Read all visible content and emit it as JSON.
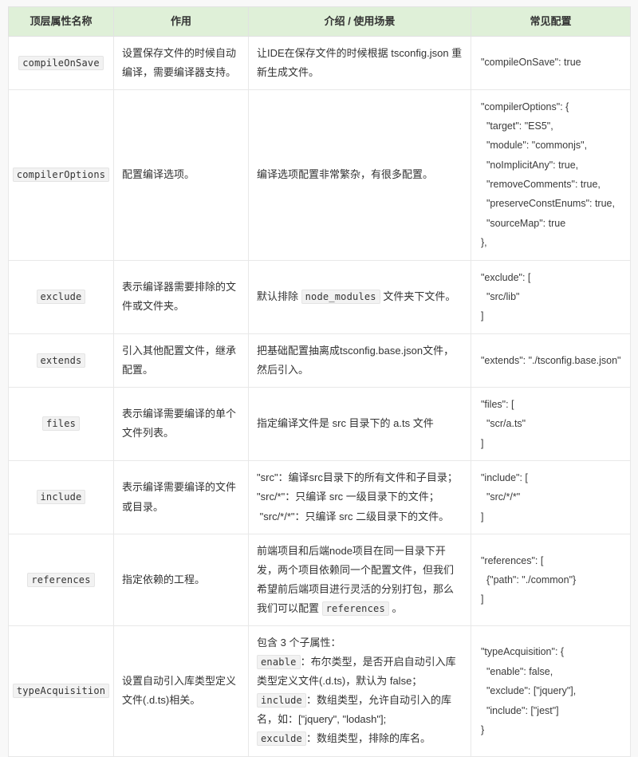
{
  "table": {
    "headers": [
      "顶层属性名称",
      "作用",
      "介绍 / 使用场景",
      "常见配置"
    ],
    "header_bg": "#dff0d8",
    "border_color": "#e2e2e2",
    "page_bg": "#f8f8f8",
    "code_bg": "#f2f2f2",
    "rows": [
      {
        "name": "compileOnSave",
        "role": "设置保存文件的时候自动编译，需要编译器支持。",
        "desc_parts": [
          {
            "type": "text",
            "value": "让IDE在保存文件的时候根据 tsconfig.json 重新生成文件。"
          }
        ],
        "config": "\"compileOnSave\": true"
      },
      {
        "name": "compilerOptions",
        "role": "配置编译选项。",
        "desc_parts": [
          {
            "type": "text",
            "value": "编译选项配置非常繁杂，有很多配置。"
          }
        ],
        "config": "\"compilerOptions\": {\n  \"target\": \"ES5\",\n  \"module\": \"commonjs\",\n  \"noImplicitAny\": true,\n  \"removeComments\": true,\n  \"preserveConstEnums\": true,\n  \"sourceMap\": true\n},"
      },
      {
        "name": "exclude",
        "role": "表示编译器需要排除的文件或文件夹。",
        "desc_parts": [
          {
            "type": "text",
            "value": "默认排除 "
          },
          {
            "type": "code",
            "value": "node_modules"
          },
          {
            "type": "text",
            "value": " 文件夹下文件。"
          }
        ],
        "config": "\"exclude\": [\n  \"src/lib\"\n]"
      },
      {
        "name": "extends",
        "role": "引入其他配置文件，继承配置。",
        "desc_parts": [
          {
            "type": "text",
            "value": "把基础配置抽离成tsconfig.base.json文件，然后引入。"
          }
        ],
        "config": "\"extends\": \"./tsconfig.base.json\""
      },
      {
        "name": "files",
        "role": "表示编译需要编译的单个文件列表。",
        "desc_parts": [
          {
            "type": "text",
            "value": "指定编译文件是 src 目录下的 a.ts 文件"
          }
        ],
        "config": "\"files\": [\n  \"scr/a.ts\"\n]"
      },
      {
        "name": "include",
        "role": "表示编译需要编译的文件或目录。",
        "desc_parts": [
          {
            "type": "text",
            "value": "\"src\"：编译src目录下的所有文件和子目录；\n\"src/*\"：只编译 src 一级目录下的文件；\n \"src/*/*\"：只编译 src 二级目录下的文件。"
          }
        ],
        "config": "\"include\": [\n  \"src/*/*\"\n]"
      },
      {
        "name": "references",
        "role": "指定依赖的工程。",
        "desc_parts": [
          {
            "type": "text",
            "value": "前端项目和后端node项目在同一目录下开发，两个项目依赖同一个配置文件，但我们希望前后端项目进行灵活的分别打包，那么我们可以配置 "
          },
          {
            "type": "code",
            "value": "references"
          },
          {
            "type": "text",
            "value": " 。"
          }
        ],
        "config": "\"references\": [\n  {\"path\": \"./common\"}\n]"
      },
      {
        "name": "typeAcquisition",
        "role": "设置自动引入库类型定义文件(.d.ts)相关。",
        "desc_parts": [
          {
            "type": "text",
            "value": "包含 3 个子属性：\n"
          },
          {
            "type": "code",
            "value": "enable"
          },
          {
            "type": "text",
            "value": "：布尔类型，是否开启自动引入库类型定义文件(.d.ts)，默认为 false；\n"
          },
          {
            "type": "code",
            "value": "include"
          },
          {
            "type": "text",
            "value": "：数组类型，允许自动引入的库名，如：[\"jquery\", \"lodash\"];\n"
          },
          {
            "type": "code",
            "value": "exculde"
          },
          {
            "type": "text",
            "value": "：数组类型，排除的库名。"
          }
        ],
        "config": "\"typeAcquisition\": {\n  \"enable\": false,\n  \"exclude\": [\"jquery\"],\n  \"include\": [\"jest\"]\n}"
      }
    ]
  }
}
